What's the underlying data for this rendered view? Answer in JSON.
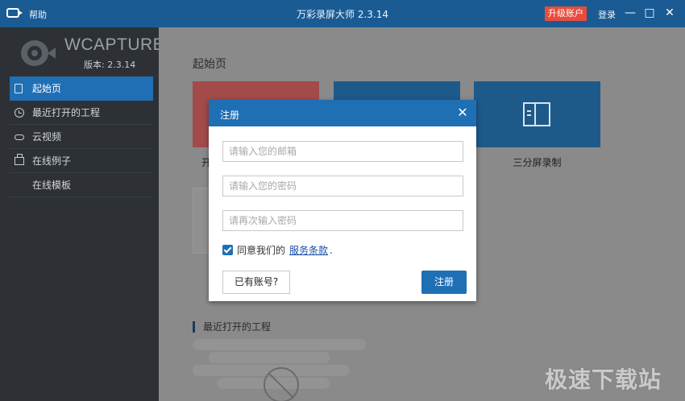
{
  "titlebar": {
    "help": "帮助",
    "title": "万彩录屏大师 2.3.14",
    "upgrade": "升级账户",
    "login": "登录",
    "minimize": "—",
    "maximize": "□",
    "close": "✕"
  },
  "sidebar": {
    "brand_name": "WCAPTURE",
    "version": "版本: 2.3.14",
    "items": [
      {
        "label": "起始页",
        "icon": "document-icon",
        "active": true
      },
      {
        "label": "最近打开的工程",
        "icon": "clock-icon"
      },
      {
        "label": "云视频",
        "icon": "cloud-icon"
      },
      {
        "label": "在线例子",
        "icon": "box-icon"
      },
      {
        "label": "在线模板",
        "icon": ""
      }
    ]
  },
  "main": {
    "heading": "起始页",
    "card1_label": "开",
    "card3_label": "三分屏录制",
    "recent_heading": "最近打开的工程",
    "watermark": "极速下载站"
  },
  "modal": {
    "title": "注册",
    "close": "✕",
    "email_placeholder": "请输入您的邮箱",
    "password_placeholder": "请输入您的密码",
    "confirm_placeholder": "请再次输入密码",
    "agree_checked": true,
    "agree_text": "同意我们的",
    "agree_link": "服务条款",
    "agree_end": ".",
    "have_account": "已有账号?",
    "register": "注册"
  },
  "colors": {
    "accent": "#1f6fb5",
    "titlebar": "#1a5b94",
    "sidebar": "#2d3136",
    "upgrade": "#e74c3c"
  }
}
